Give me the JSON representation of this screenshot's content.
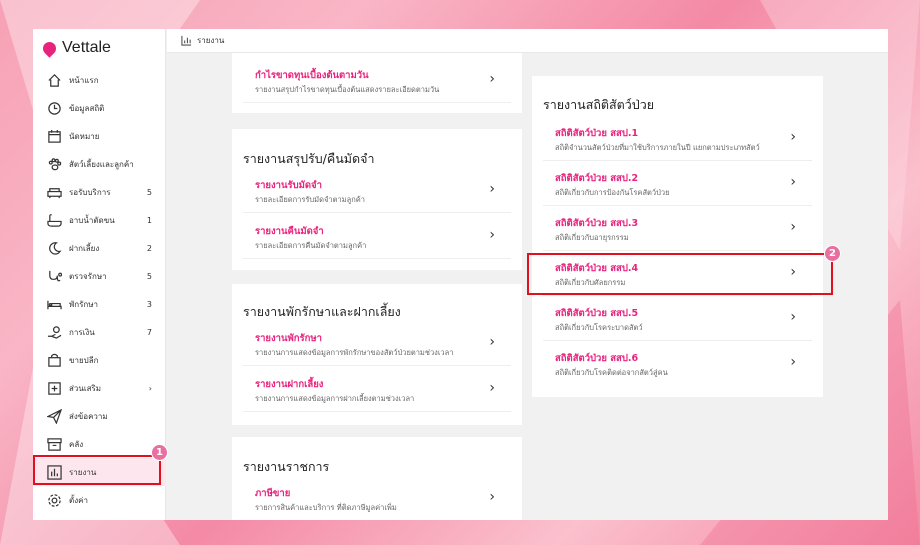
{
  "app": {
    "name": "Vettale"
  },
  "topbar": {
    "title": "รายงาน"
  },
  "sidebar": {
    "items": [
      {
        "label": "หน้าแรก",
        "count": ""
      },
      {
        "label": "ข้อมูลสถิติ",
        "count": ""
      },
      {
        "label": "นัดหมาย",
        "count": ""
      },
      {
        "label": "สัตว์เลี้ยงและลูกค้า",
        "count": ""
      },
      {
        "label": "รอรับบริการ",
        "count": "5"
      },
      {
        "label": "อาบน้ำตัดขน",
        "count": "1"
      },
      {
        "label": "ฝากเลี้ยง",
        "count": "2"
      },
      {
        "label": "ตรวจรักษา",
        "count": "5"
      },
      {
        "label": "พักรักษา",
        "count": "3"
      },
      {
        "label": "การเงิน",
        "count": "7"
      },
      {
        "label": "ขายปลีก",
        "count": ""
      },
      {
        "label": "ส่วนเสริม",
        "count": "›"
      },
      {
        "label": "ส่งข้อความ",
        "count": ""
      },
      {
        "label": "คลัง",
        "count": ""
      },
      {
        "label": "รายงาน",
        "count": ""
      },
      {
        "label": "ตั้งค่า",
        "count": ""
      }
    ]
  },
  "cards": {
    "top": {
      "rows": [
        {
          "title": "กำไรขาดทุนเบื้องต้นตามวัน",
          "sub": "รายงานสรุปกำไรขาดทุนเบื้องต้นแสดงรายละเอียดตามวัน"
        }
      ]
    },
    "deposit": {
      "title": "รายงานสรุปรับ/คืนมัดจำ",
      "rows": [
        {
          "title": "รายงานรับมัดจำ",
          "sub": "รายละเอียดการรับมัดจำตามลูกค้า"
        },
        {
          "title": "รายงานคืนมัดจำ",
          "sub": "รายละเอียดการคืนมัดจำตามลูกค้า"
        }
      ]
    },
    "hospital": {
      "title": "รายงานพักรักษาและฝากเลี้ยง",
      "rows": [
        {
          "title": "รายงานพักรักษา",
          "sub": "รายงานการแสดงข้อมูลการพักรักษาของสัตว์ป่วยตามช่วงเวลา"
        },
        {
          "title": "รายงานฝากเลี้ยง",
          "sub": "รายงานการแสดงข้อมูลการฝากเลี้ยงตามช่วงเวลา"
        }
      ]
    },
    "gov": {
      "title": "รายงานราชการ",
      "rows": [
        {
          "title": "ภาษีขาย",
          "sub": "รายการสินค้าและบริการ ที่ติดภาษีมูลค่าเพิ่ม"
        }
      ]
    },
    "stats": {
      "title": "รายงานสถิติสัตว์ป่วย",
      "rows": [
        {
          "title": "สถิติสัตว์ป่วย สสป.1",
          "sub": "สถิติจำนวนสัตว์ป่วยที่มาใช้บริการภายในปี แยกตามประเภทสัตว์"
        },
        {
          "title": "สถิติสัตว์ป่วย สสป.2",
          "sub": "สถิติเกี่ยวกับการป้องกันโรคสัตว์ป่วย"
        },
        {
          "title": "สถิติสัตว์ป่วย สสป.3",
          "sub": "สถิติเกี่ยวกับอายุรกรรม"
        },
        {
          "title": "สถิติสัตว์ป่วย สสป.4",
          "sub": "สถิติเกี่ยวกับศัลยกรรม"
        },
        {
          "title": "สถิติสัตว์ป่วย สสป.5",
          "sub": "สถิติเกี่ยวกับโรคระบาดสัตว์"
        },
        {
          "title": "สถิติสัตว์ป่วย สสป.6",
          "sub": "สถิติเกี่ยวกับโรคติดต่อจากสัตว์สู่คน"
        }
      ]
    }
  },
  "annotations": {
    "badge1": "1",
    "badge2": "2"
  },
  "colors": {
    "accent": "#e8237e",
    "highlight": "#e0101e",
    "badge": "#e96fa0"
  }
}
